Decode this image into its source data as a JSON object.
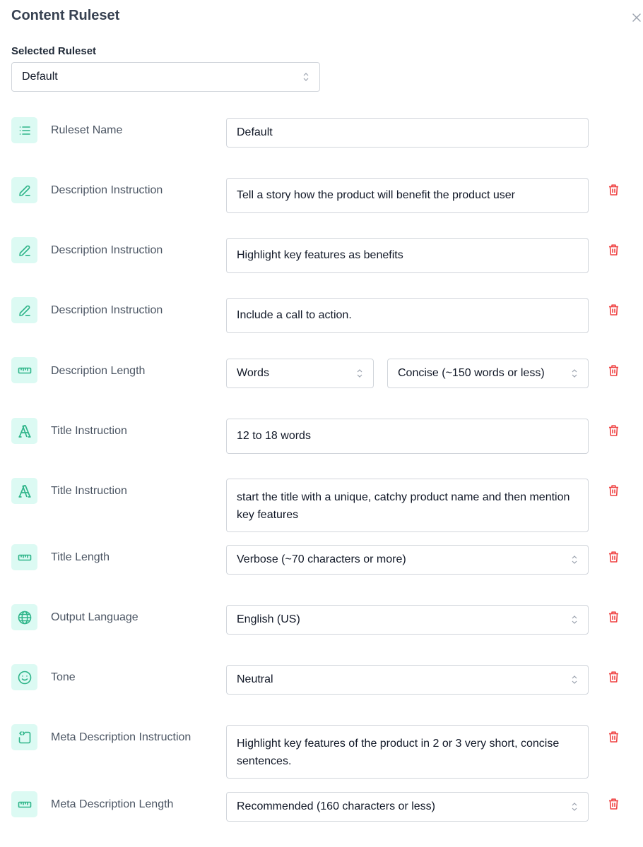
{
  "header": {
    "title": "Content Ruleset",
    "close_icon": "close-icon"
  },
  "selected_ruleset": {
    "label": "Selected Ruleset",
    "value": "Default"
  },
  "colors": {
    "accent": "#2fb58a",
    "icon_bg": "#dcfaf3",
    "danger": "#ef4444",
    "label": "#4b5563"
  },
  "rules": [
    {
      "icon": "list-icon",
      "label": "Ruleset Name",
      "type": "input",
      "value": "Default",
      "deletable": false
    },
    {
      "icon": "pencil-icon",
      "label": "Description Instruction",
      "type": "input",
      "value": "Tell a story how the product will benefit the product user",
      "deletable": true
    },
    {
      "icon": "pencil-icon",
      "label": "Description Instruction",
      "type": "input",
      "value": "Highlight key features as benefits",
      "deletable": true
    },
    {
      "icon": "pencil-icon",
      "label": "Description Instruction",
      "type": "input",
      "value": "Include a call to action.",
      "deletable": true
    },
    {
      "icon": "ruler-icon",
      "label": "Description Length",
      "type": "double-select",
      "unit": "Words",
      "value": "Concise (~150 words or less)",
      "deletable": true
    },
    {
      "icon": "font-icon",
      "label": "Title Instruction",
      "type": "input",
      "value": "12 to 18 words",
      "deletable": true
    },
    {
      "icon": "font-icon",
      "label": "Title Instruction",
      "type": "textarea",
      "value": "start the title with a unique, catchy product name and then mention key features",
      "deletable": true
    },
    {
      "icon": "ruler-icon",
      "label": "Title Length",
      "type": "select",
      "value": "Verbose (~70 characters or more)",
      "deletable": true
    },
    {
      "icon": "globe-icon",
      "label": "Output Language",
      "type": "select",
      "value": "English (US)",
      "deletable": true
    },
    {
      "icon": "smile-icon",
      "label": "Tone",
      "type": "select",
      "value": "Neutral",
      "deletable": true
    },
    {
      "icon": "code-box-icon",
      "label": "Meta Description Instruction",
      "type": "textarea",
      "value": "Highlight key features of the product in 2 or 3 very short, concise sentences.",
      "deletable": true
    },
    {
      "icon": "ruler-icon",
      "label": "Meta Description Length",
      "type": "select",
      "value": "Recommended (160 characters or less)",
      "deletable": true
    }
  ]
}
